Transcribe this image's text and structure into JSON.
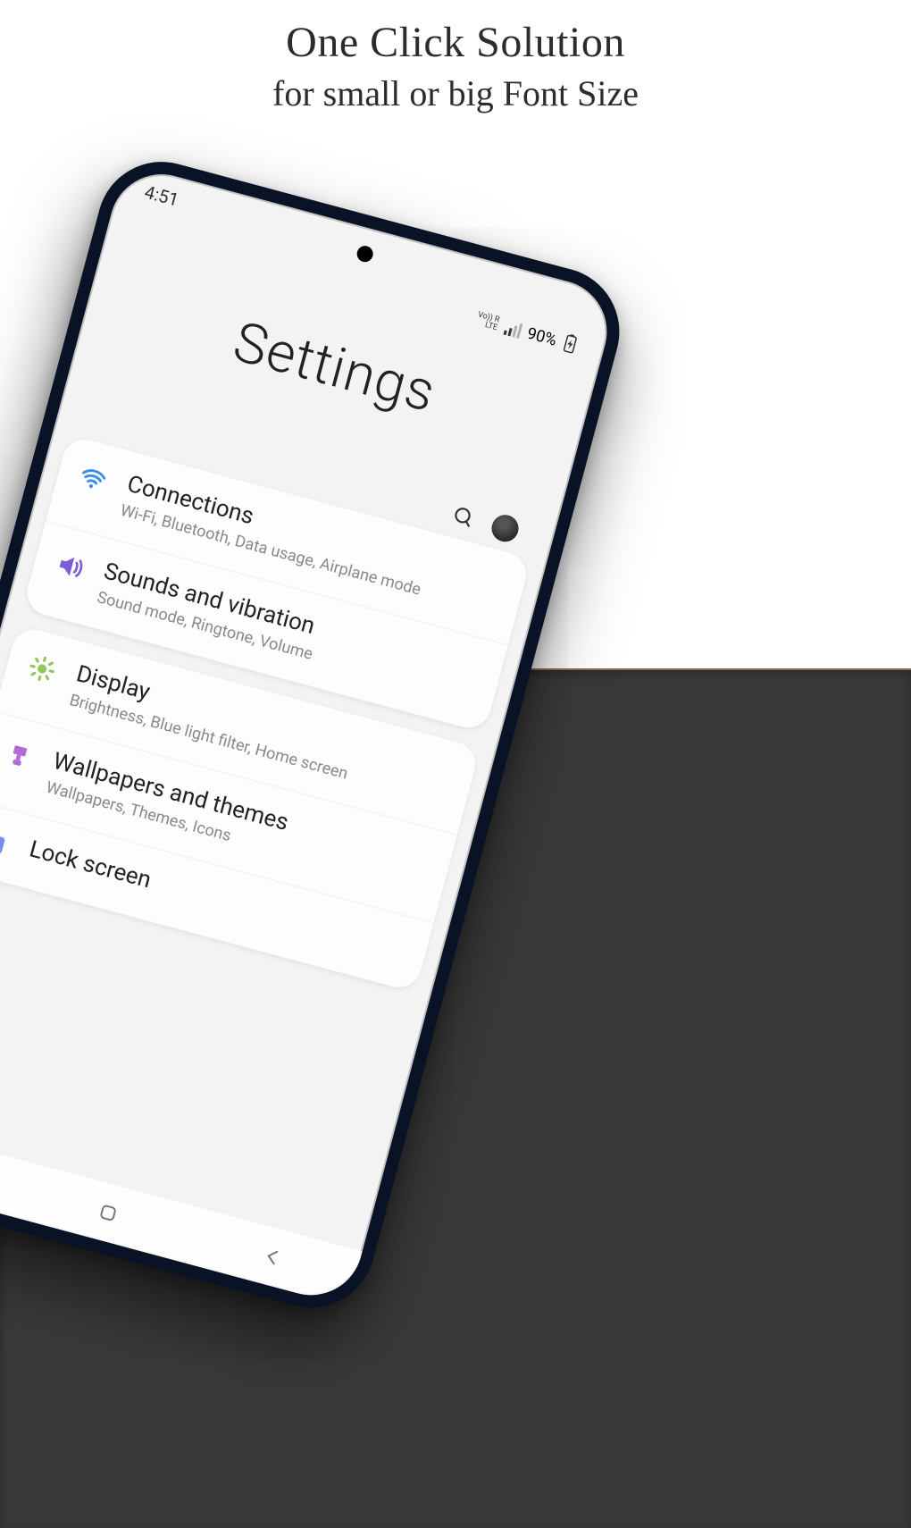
{
  "marketing": {
    "line1": "One Click Solution",
    "line2": "for small or big Font Size"
  },
  "statusbar": {
    "time": "4:51",
    "network_label": "Vo)) R\nLTE",
    "battery_percent": "90%",
    "charging": true
  },
  "header": {
    "title": "Settings"
  },
  "groups": [
    {
      "rows": [
        {
          "icon": "wifi",
          "icon_color": "#3a8ee6",
          "title": "Connections",
          "subtitle": "Wi-Fi, Bluetooth, Data usage, Airplane mode"
        },
        {
          "icon": "volume",
          "icon_color": "#7b5ed6",
          "title": "Sounds and vibration",
          "subtitle": "Sound mode, Ringtone, Volume"
        }
      ]
    },
    {
      "rows": [
        {
          "icon": "sun",
          "icon_color": "#8ec95a",
          "title": "Display",
          "subtitle": "Brightness, Blue light filter, Home screen"
        },
        {
          "icon": "brush",
          "icon_color": "#b469d9",
          "title": "Wallpapers and themes",
          "subtitle": "Wallpapers, Themes, Icons"
        },
        {
          "icon": "lock",
          "icon_color": "#7b8cf0",
          "title": "Lock screen",
          "subtitle": ""
        }
      ]
    }
  ]
}
